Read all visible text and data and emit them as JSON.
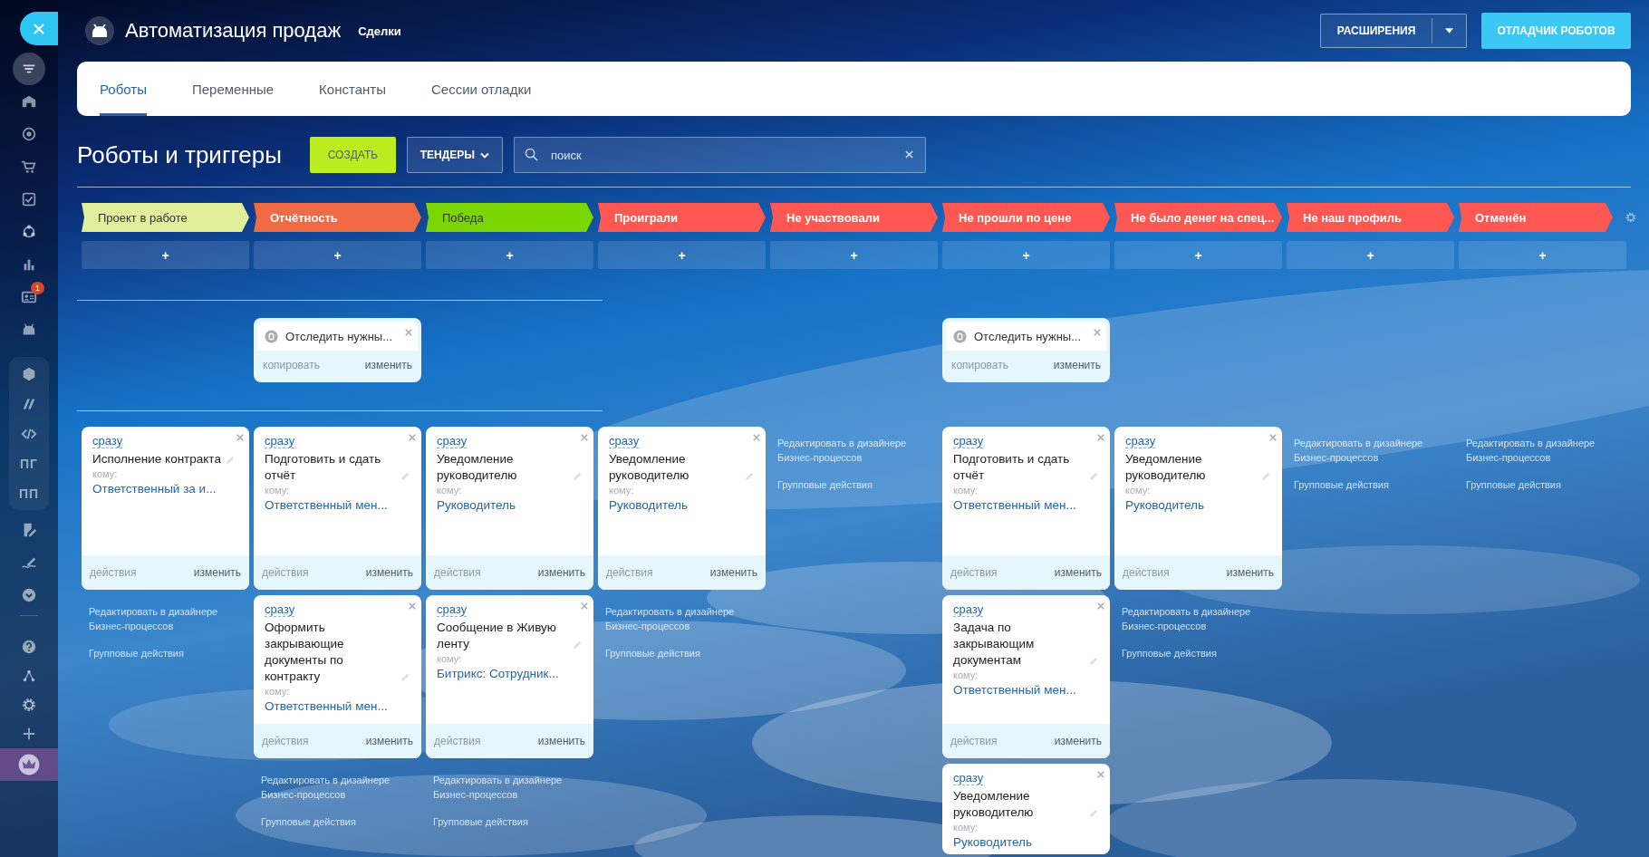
{
  "sidebar": {
    "sections": [
      {
        "kind": "close"
      },
      {
        "kind": "plain",
        "items": [
          {
            "kind": "icon",
            "selected": true
          },
          {
            "kind": "icon",
            "selected": false
          },
          {
            "kind": "icon",
            "selected": false
          },
          {
            "kind": "icon",
            "selected": false
          },
          {
            "kind": "icon",
            "selected": false
          },
          {
            "kind": "icon",
            "selected": false
          },
          {
            "kind": "icon",
            "selected": false
          },
          {
            "kind": "icon",
            "selected": false,
            "badge": "1"
          },
          {
            "kind": "icon",
            "selected": false
          }
        ]
      },
      {
        "kind": "group",
        "items": [
          {
            "kind": "icon",
            "selected": false
          },
          {
            "kind": "icon",
            "selected": false
          },
          {
            "kind": "icon",
            "selected": false
          },
          {
            "kind": "text",
            "label": "ПГ",
            "selected": false
          },
          {
            "kind": "text",
            "label": "ПП",
            "selected": false
          }
        ]
      },
      {
        "kind": "plain",
        "items": [
          {
            "kind": "icon",
            "selected": false
          },
          {
            "kind": "icon",
            "selected": false
          },
          {
            "kind": "icon",
            "selected": false
          }
        ]
      },
      {
        "kind": "divider"
      },
      {
        "kind": "small",
        "items": [
          {
            "kind": "icon",
            "selected": false
          },
          {
            "kind": "icon",
            "selected": false
          },
          {
            "kind": "icon",
            "selected": false
          },
          {
            "kind": "icon",
            "selected": false
          }
        ]
      },
      {
        "kind": "promo",
        "items": [
          {
            "kind": "icon",
            "selected": false
          }
        ]
      }
    ]
  },
  "header": {
    "title": "Автоматизация продаж",
    "subtitle": "Сделки",
    "buttons": [
      {
        "kind": "split",
        "label": "РАСШИРЕНИЯ"
      },
      {
        "kind": "primary",
        "label": "ОТЛАДЧИК РОБОТОВ"
      }
    ]
  },
  "tabs": [
    {
      "label": "Роботы",
      "selected": true
    },
    {
      "label": "Переменные",
      "selected": false
    },
    {
      "label": "Константы",
      "selected": false
    },
    {
      "label": "Сессии отладки",
      "selected": false
    }
  ],
  "toolbar": {
    "title": "Роботы и триггеры",
    "create": "СОЗДАТЬ",
    "category": "ТЕНДЕРЫ",
    "search": {
      "placeholder": "поиск"
    }
  },
  "stages": [
    {
      "label": "Проект в работе",
      "color": "#e2ef9a",
      "light": true,
      "add": "+",
      "robots": [
        {
          "when": "сразу",
          "title": "Исполнение контракта",
          "to": "кому:",
          "recipient": "Ответственный за и...",
          "footer": {
            "actions": "действия",
            "edit": "изменить"
          }
        }
      ],
      "links": [
        "Редактировать в дизайнере Бизнес-процессов",
        "Групповые действия"
      ]
    },
    {
      "label": "Отчётность",
      "color": "#f06a45",
      "light": false,
      "add": "+",
      "triggers": [
        {
          "title": "Отследить нужны...",
          "copy": "копировать",
          "edit": "изменить"
        }
      ],
      "robots": [
        {
          "when": "сразу",
          "title": "Подготовить и сдать отчёт",
          "to": "кому:",
          "recipient": "Ответственный мен...",
          "footer": {
            "actions": "действия",
            "edit": "изменить"
          }
        },
        {
          "when": "сразу",
          "title": "Оформить закрывающие документы по контракту",
          "to": "кому:",
          "recipient": "Ответственный мен...",
          "footer": {
            "actions": "действия",
            "edit": "изменить"
          }
        }
      ],
      "links": [
        "Редактировать в дизайнере Бизнес-процессов",
        "Групповые действия"
      ]
    },
    {
      "label": "Победа",
      "color": "#7bd500",
      "light": true,
      "add": "+",
      "robots": [
        {
          "when": "сразу",
          "title": "Уведомление руководителю",
          "to": "кому:",
          "recipient": "Руководитель",
          "footer": {
            "actions": "действия",
            "edit": "изменить"
          }
        },
        {
          "when": "сразу",
          "title": "Сообщение в Живую ленту",
          "to": "кому:",
          "recipient": "Битрикс: Сотрудник...",
          "footer": {
            "actions": "действия",
            "edit": "изменить"
          }
        }
      ],
      "links": [
        "Редактировать в дизайнере Бизнес-процессов",
        "Групповые действия"
      ]
    },
    {
      "label": "Проиграли",
      "color": "#ff5752",
      "light": false,
      "add": "+",
      "robots": [
        {
          "when": "сразу",
          "title": "Уведомление руководителю",
          "to": "кому:",
          "recipient": "Руководитель",
          "footer": {
            "actions": "действия",
            "edit": "изменить"
          }
        }
      ],
      "links": [
        "Редактировать в дизайнере Бизнес-процессов",
        "Групповые действия"
      ]
    },
    {
      "label": "Не участвовали",
      "color": "#ff5752",
      "light": false,
      "add": "+",
      "links": [
        "Редактировать в дизайнере Бизнес-процессов",
        "Групповые действия"
      ]
    },
    {
      "label": "Не прошли по цене",
      "color": "#ff5752",
      "light": false,
      "add": "+",
      "triggers": [
        {
          "title": "Отследить нужны...",
          "copy": "копировать",
          "edit": "изменить"
        }
      ],
      "robots": [
        {
          "when": "сразу",
          "title": "Подготовить и сдать отчёт",
          "to": "кому:",
          "recipient": "Ответственный мен...",
          "footer": {
            "actions": "действия",
            "edit": "изменить"
          }
        },
        {
          "when": "сразу",
          "title": "Задача по закрывающим документам",
          "to": "кому:",
          "recipient": "Ответственный мен...",
          "footer": {
            "actions": "действия",
            "edit": "изменить"
          }
        },
        {
          "when": "сразу",
          "title": "Уведомление руководителю",
          "to": "кому:",
          "recipient": "Руководитель"
        }
      ]
    },
    {
      "label": "Не было денег на спец...",
      "color": "#ff5752",
      "light": false,
      "add": "+",
      "robots": [
        {
          "when": "сразу",
          "title": "Уведомление руководителю",
          "to": "кому:",
          "recipient": "Руководитель",
          "footer": {
            "actions": "действия",
            "edit": "изменить"
          }
        }
      ],
      "links": [
        "Редактировать в дизайнере Бизнес-процессов",
        "Групповые действия"
      ]
    },
    {
      "label": "Не наш профиль",
      "color": "#ff5752",
      "light": false,
      "add": "+",
      "links": [
        "Редактировать в дизайнере Бизнес-процессов",
        "Групповые действия"
      ]
    },
    {
      "label": "Отменён",
      "color": "#ff5752",
      "light": false,
      "add": "+",
      "links": [
        "Редактировать в дизайнере Бизнес-процессов",
        "Групповые действия"
      ]
    }
  ]
}
